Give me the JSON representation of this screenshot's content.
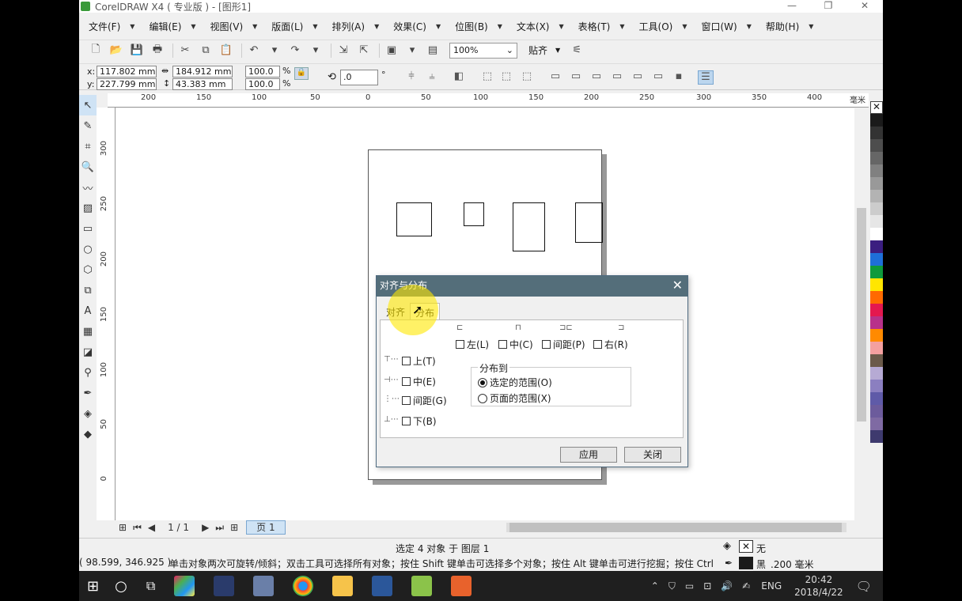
{
  "window": {
    "title": "CorelDRAW X4 ( 专业版 ) - [图形1]",
    "min": "—",
    "max": "❐",
    "close": "✕"
  },
  "menu": [
    "文件(F)",
    "编辑(E)",
    "视图(V)",
    "版面(L)",
    "排列(A)",
    "效果(C)",
    "位图(B)",
    "文本(X)",
    "表格(T)",
    "工具(O)",
    "窗口(W)",
    "帮助(H)"
  ],
  "toolbar": {
    "zoom": "100%",
    "snap": "贴齐"
  },
  "properties": {
    "x_label": "x:",
    "x_value": "117.802 mm",
    "y_label": "y:",
    "y_value": "227.799 mm",
    "w_value": "184.912 mm",
    "h_value": "43.383 mm",
    "scale_w": "100.0",
    "scale_h": "100.0",
    "pct": "%",
    "rotation": ".0",
    "deg": "°"
  },
  "ruler": {
    "h_ticks": [
      "200",
      "150",
      "100",
      "50",
      "0",
      "50",
      "100",
      "150",
      "200",
      "250",
      "300",
      "350",
      "400",
      "毫米"
    ],
    "v_ticks": [
      "300",
      "250",
      "200",
      "150",
      "100",
      "50",
      "0"
    ]
  },
  "nav": {
    "page_count": "1 / 1",
    "page_tab": "页 1"
  },
  "status": {
    "selection": "选定 4 对象 于 图层 1",
    "coords": "( 98.599, 346.925 )",
    "hint": "单击对象两次可旋转/倾斜；双击工具可选择所有对象；按住 Shift 键单击可选择多个对象；按住 Alt 键单击可进行挖掘；按住 Ctrl ...",
    "fill": "无",
    "outline": "黑",
    "outline_width": ".200 毫米"
  },
  "dialog": {
    "title": "对齐与分布",
    "tabs": [
      "对齐",
      "分布"
    ],
    "horizontal": [
      "左(L)",
      "中(C)",
      "间距(P)",
      "右(R)"
    ],
    "vertical": [
      "上(T)",
      "中(E)",
      "间距(G)",
      "下(B)"
    ],
    "distribute_to": "分布到",
    "range_selection": "选定的范围(O)",
    "range_page": "页面的范围(X)",
    "apply": "应用",
    "close": "关闭"
  },
  "taskbar": {
    "lang": "ENG",
    "time": "20:42",
    "date": "2018/4/22"
  },
  "colors": {
    "palette": [
      "#1a1a1a",
      "#333333",
      "#4d4d4d",
      "#666666",
      "#808080",
      "#999999",
      "#b3b3b3",
      "#cccccc",
      "#e6e6e6",
      "#ffffff",
      "#3b1e80",
      "#1e6fd9",
      "#0e9a3c",
      "#ffe600",
      "#ff6a00",
      "#e4184f",
      "#b8318a",
      "#ff8a00",
      "#f4a0a0",
      "#6b5a4a",
      "#b6aad4",
      "#8b7fc0",
      "#5f5aa8",
      "#6c5b9c",
      "#7f6aa3",
      "#3e3a6e"
    ]
  }
}
